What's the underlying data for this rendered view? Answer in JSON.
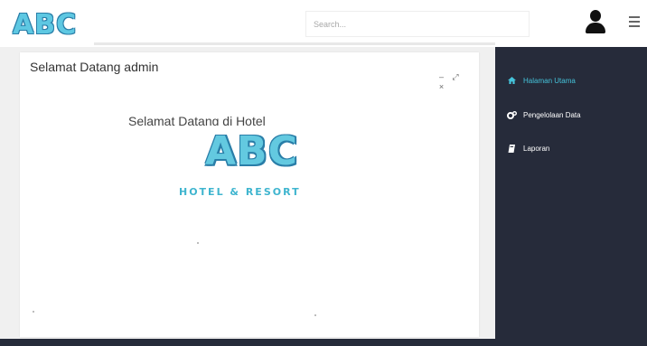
{
  "brand": {
    "logo_text": "ABC"
  },
  "search": {
    "placeholder": "Search..."
  },
  "panel": {
    "title": "Selamat Datang admin",
    "tools": {
      "minimize": "–",
      "expand": "⤢",
      "close": "×"
    },
    "welcome_text": "Selamat Datang di Hotel",
    "logo": {
      "name": "ABC",
      "tagline": "HOTEL & RESORT"
    }
  },
  "sidebar": {
    "items": [
      {
        "label": "Halaman Utama",
        "icon": "home-icon",
        "active": true
      },
      {
        "label": "Pengelolaan Data",
        "icon": "cogs-icon",
        "active": false
      },
      {
        "label": "Laporan",
        "icon": "book-icon",
        "active": false
      }
    ]
  },
  "colors": {
    "accent": "#45c3da",
    "sidebar_bg": "#262b3a",
    "logo_fill": "#5ec8e2",
    "logo_outline": "#2a7ea8"
  }
}
